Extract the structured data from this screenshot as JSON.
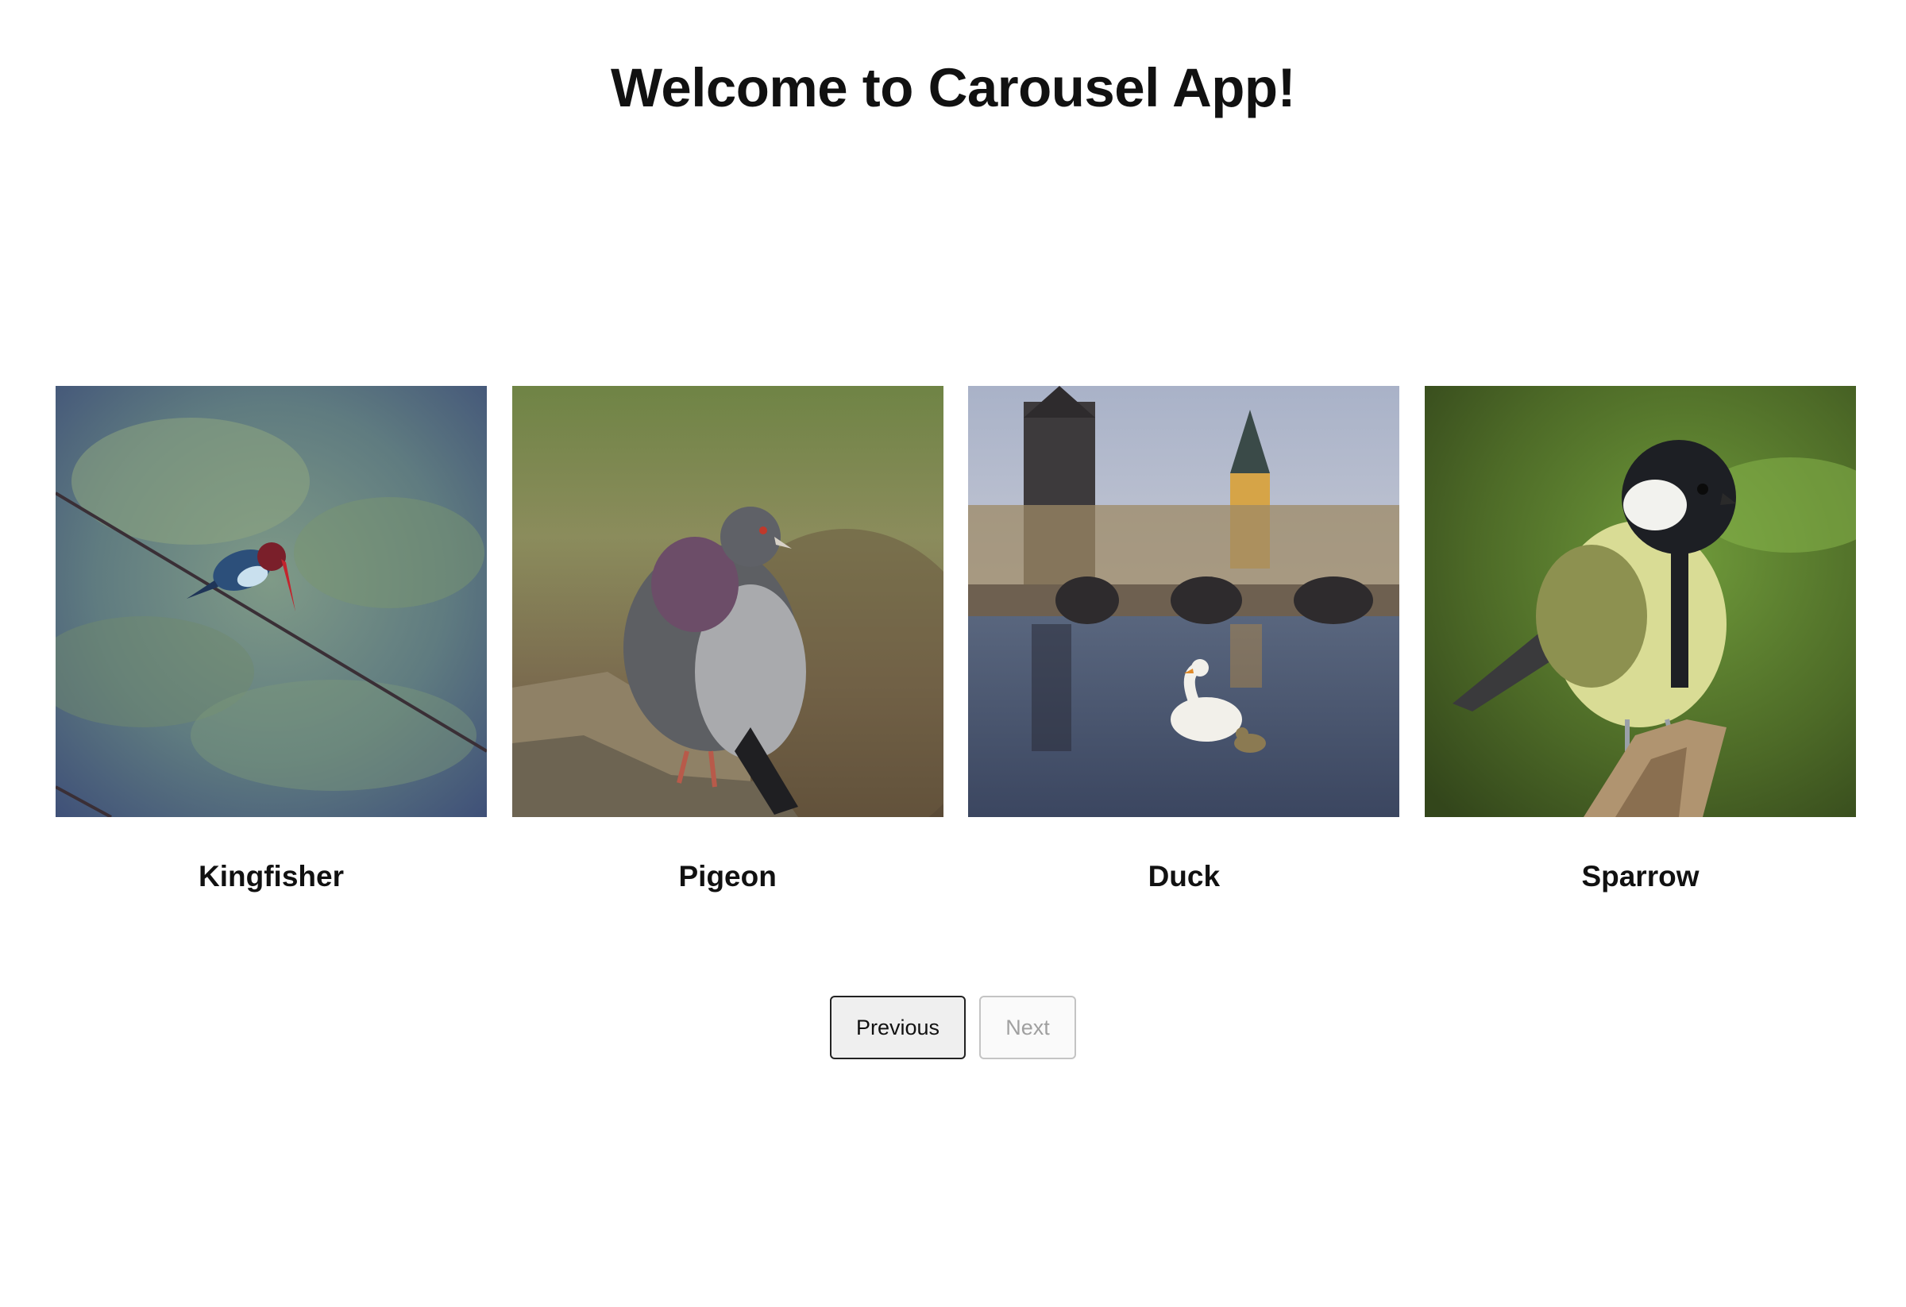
{
  "header": {
    "title": "Welcome to Carousel App!"
  },
  "carousel": {
    "items": [
      {
        "label": "Kingfisher",
        "image_icon": "kingfisher-photo"
      },
      {
        "label": "Pigeon",
        "image_icon": "pigeon-photo"
      },
      {
        "label": "Duck",
        "image_icon": "duck-photo"
      },
      {
        "label": "Sparrow",
        "image_icon": "sparrow-photo"
      }
    ]
  },
  "pager": {
    "previous_label": "Previous",
    "next_label": "Next",
    "next_disabled": true
  },
  "colors": {
    "background": "#ffffff",
    "text": "#111111",
    "button_bg": "#efefef",
    "button_border": "#222222",
    "disabled_text": "#a0a0a0"
  }
}
